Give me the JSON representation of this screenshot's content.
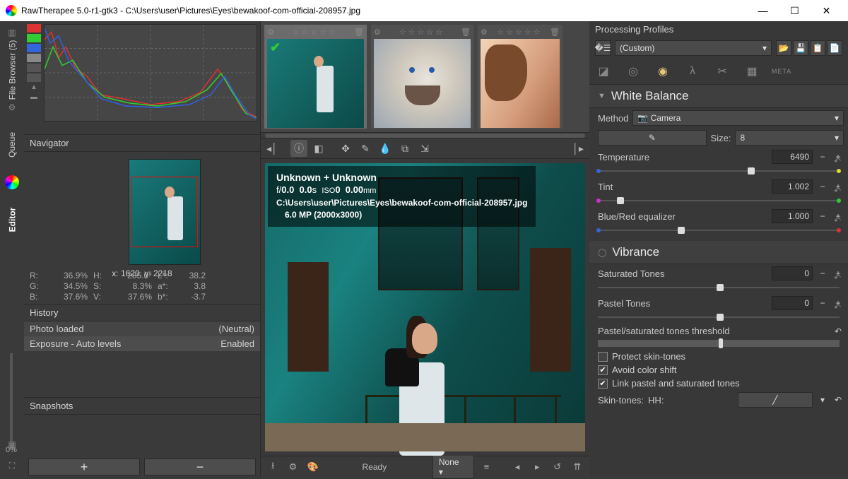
{
  "title": "RawTherapee 5.0-r1-gtk3 - C:\\Users\\user\\Pictures\\Eyes\\bewakoof-com-official-208957.jpg",
  "leftbar": {
    "tabs": [
      "File Browser (5)",
      "Queue",
      "Editor"
    ]
  },
  "navigator": {
    "header": "Navigator",
    "coords": "x: 1620, y: 2218",
    "r": "36.9%",
    "g": "34.5%",
    "b": "37.6%",
    "h": "285.0°",
    "s": "8.3%",
    "v": "37.6%",
    "L": "38.2",
    "a": "3.8",
    "bb": "-3.7",
    "rl": "R:",
    "gl": "G:",
    "bl": "B:",
    "hl": "H:",
    "sl": "S:",
    "vl": "V:",
    "Ll": "L*:",
    "al": "a*:",
    "bbl": "b*:"
  },
  "history": {
    "header": "History",
    "rows": [
      {
        "l": "Photo loaded",
        "r": "(Neutral)"
      },
      {
        "l": "Exposure - Auto levels",
        "r": "Enabled"
      }
    ]
  },
  "snapshots": {
    "header": "Snapshots"
  },
  "zoom": "0%",
  "viewerInfo": {
    "line1": "Unknown + Unknown",
    "line2": "f/0.0  0.0s  ISO0  0.00mm",
    "line3": "C:\\Users\\user\\Pictures\\Eyes\\bewakoof-com-official-208957.jpg",
    "line4": "6.0 MP (2000x3000)",
    "line2_f": "f/",
    "line2_fv": "0.0",
    "line2_sv": "0.0",
    "line2_su": "s",
    "line2_iso": "ISO",
    "line2_isov": "0",
    "line2_mmv": "0.00",
    "line2_mmu": "mm"
  },
  "status": {
    "ready": "Ready",
    "none": "None"
  },
  "pp": {
    "header": "Processing Profiles",
    "profile": "(Custom)"
  },
  "wb": {
    "header": "White Balance",
    "methodLabel": "Method",
    "method": "Camera",
    "sizeLabel": "Size:",
    "size": "8",
    "tempLabel": "Temperature",
    "temp": "6490",
    "tintLabel": "Tint",
    "tint": "1.002",
    "brLabel": "Blue/Red equalizer",
    "br": "1.000"
  },
  "vib": {
    "header": "Vibrance",
    "satLabel": "Saturated Tones",
    "sat": "0",
    "pasLabel": "Pastel Tones",
    "pas": "0",
    "thrLabel": "Pastel/saturated tones threshold",
    "c1": "Protect skin-tones",
    "c2": "Avoid color shift",
    "c3": "Link pastel and saturated tones",
    "skinLabel": "Skin-tones:",
    "skinMode": "HH:"
  },
  "meta": "META",
  "stars": "☆ ☆ ☆ ☆ ☆",
  "plus": "+",
  "minus": "−"
}
